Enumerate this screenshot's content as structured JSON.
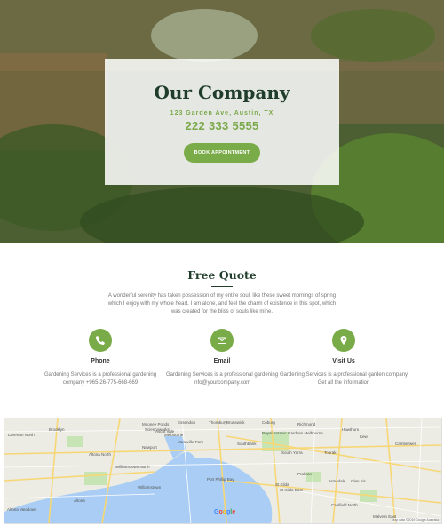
{
  "hero": {
    "title": "Our Company",
    "address": "123 Garden Ave, Austin, TX",
    "phone": "222 333 5555",
    "button_label": "BOOK APPOINTMENT"
  },
  "quote": {
    "heading": "Free Quote",
    "paragraph": "A wonderful serenity has taken possession of my entire soul, like these sweet mornings of spring which I enjoy with my whole heart. I am alone, and feel the charm of existence in this spot, which was created for the bliss of souls like mine."
  },
  "features": [
    {
      "label": "Phone",
      "desc": "Gardening Services is a professional gardening company +965-26-775-668-669",
      "icon": "phone-icon"
    },
    {
      "label": "Email",
      "desc": "Gardening Services is a professional gardening info@yourcompany.com",
      "icon": "mail-icon"
    },
    {
      "label": "Visit Us",
      "desc": "Gardening Services is a professional garden company Get all the information",
      "icon": "location-pin-icon"
    }
  ],
  "map": {
    "labels": [
      "Laverton North",
      "Brooklyn",
      "Moonee Ponds",
      "Ascot Vale",
      "Essendon",
      "Brunswick",
      "Coburg",
      "Northcote",
      "Preston",
      "Thornbury",
      "Fitzroy",
      "Collingwood",
      "Richmond",
      "Hawthorn",
      "Kew",
      "Camberwell",
      "Footscray",
      "Melbourne",
      "Yarraville",
      "Altona North",
      "Newport",
      "Williamstown",
      "Williamstown North",
      "Altona",
      "Altona Meadows",
      "Port Phillip Bay",
      "South Yarra",
      "Prahran",
      "St Kilda",
      "St Kilda East",
      "Elsternwick",
      "Caulfield North",
      "Malvern East",
      "Carnegie",
      "Glen Iris",
      "Armadale",
      "Toorak",
      "Brighton",
      "Royal Botanic Gardens Melbourne",
      "Southbank",
      "Docklands",
      "Scienceworks",
      "Yarraville Park"
    ],
    "google": "Google",
    "attribution": "Map data ©2019 Google   Australia"
  },
  "colors": {
    "accent": "#79ab48",
    "dark": "#1f3d2a"
  }
}
